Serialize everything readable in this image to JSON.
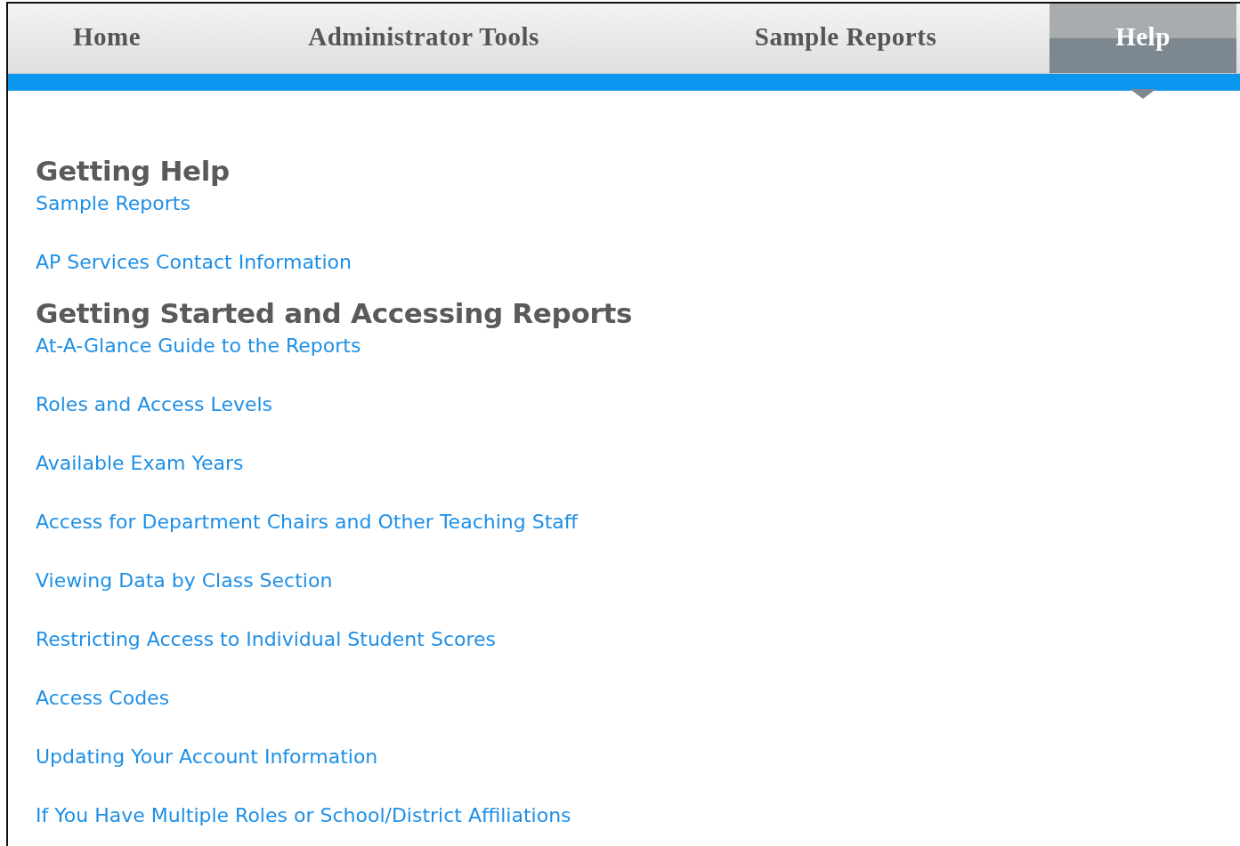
{
  "tabs": [
    {
      "label": "Home",
      "selected": false
    },
    {
      "label": "Administrator Tools",
      "selected": false
    },
    {
      "label": "Sample Reports",
      "selected": false
    },
    {
      "label": "Help",
      "selected": true
    }
  ],
  "sections": [
    {
      "title": "Getting Help",
      "links": [
        "Sample Reports",
        "AP Services Contact Information"
      ]
    },
    {
      "title": "Getting Started and Accessing Reports",
      "links": [
        "At-A-Glance Guide to the Reports",
        "Roles and Access Levels",
        "Available Exam Years",
        "Access for Department Chairs and Other Teaching Staff",
        "Viewing Data by Class Section",
        "Restricting Access to Individual Student Scores",
        "Access Codes",
        "Updating Your Account Information",
        "If You Have Multiple Roles or School/District Affiliations"
      ]
    }
  ]
}
